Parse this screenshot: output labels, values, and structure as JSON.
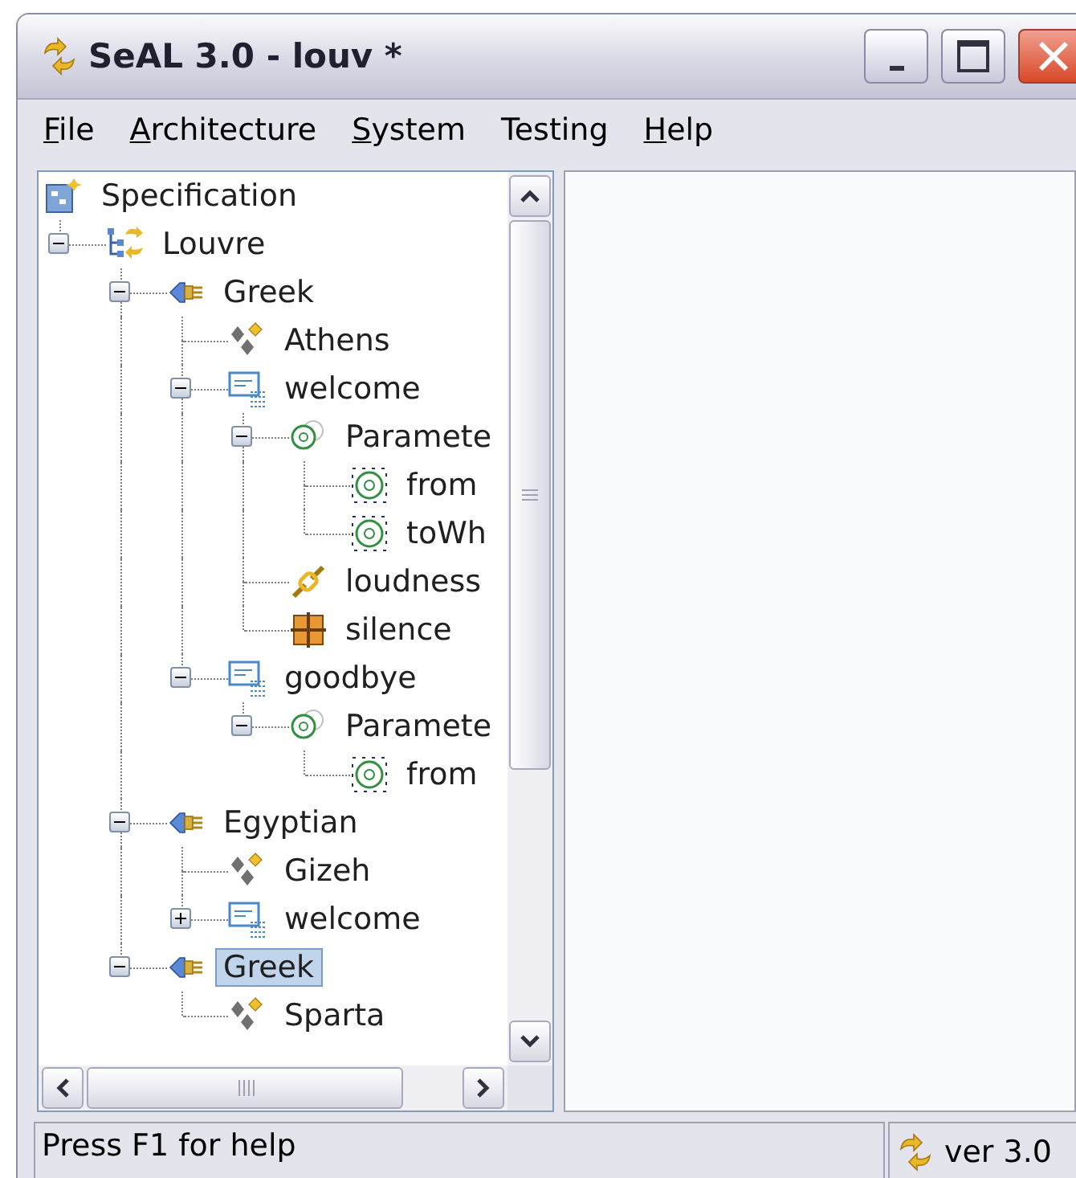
{
  "window": {
    "title": "SeAL 3.0 - louv *"
  },
  "menu": [
    {
      "label": "File",
      "underlined": true
    },
    {
      "label": "Architecture",
      "underlined": true
    },
    {
      "label": "System",
      "underlined": true
    },
    {
      "label": "Testing",
      "underlined": false
    },
    {
      "label": "Help",
      "underlined": true
    }
  ],
  "tree": {
    "label": "Specification",
    "kind": "specification",
    "selected": false,
    "children": [
      {
        "label": "Louvre",
        "kind": "system",
        "selected": false,
        "expanded": true,
        "children": [
          {
            "label": "Greek",
            "kind": "component",
            "selected": false,
            "expanded": true,
            "children": [
              {
                "label": "Athens",
                "kind": "node",
                "selected": false
              },
              {
                "label": "welcome",
                "kind": "interface",
                "selected": false,
                "expanded": true,
                "children": [
                  {
                    "label": "Paramete",
                    "kind": "parameters",
                    "selected": false,
                    "expanded": true,
                    "children": [
                      {
                        "label": "from",
                        "kind": "parameter",
                        "selected": false
                      },
                      {
                        "label": "toWh",
                        "kind": "parameter",
                        "selected": false
                      }
                    ]
                  },
                  {
                    "label": "loudness",
                    "kind": "link",
                    "selected": false
                  },
                  {
                    "label": "silence",
                    "kind": "grid",
                    "selected": false
                  }
                ]
              },
              {
                "label": "goodbye",
                "kind": "interface",
                "selected": false,
                "expanded": true,
                "children": [
                  {
                    "label": "Paramete",
                    "kind": "parameters",
                    "selected": false,
                    "expanded": true,
                    "children": [
                      {
                        "label": "from",
                        "kind": "parameter",
                        "selected": false
                      }
                    ]
                  }
                ]
              }
            ]
          },
          {
            "label": "Egyptian",
            "kind": "component",
            "selected": false,
            "expanded": true,
            "children": [
              {
                "label": "Gizeh",
                "kind": "node",
                "selected": false
              },
              {
                "label": "welcome",
                "kind": "interface",
                "selected": false,
                "expanded": false
              }
            ]
          },
          {
            "label": "Greek",
            "kind": "component",
            "selected": true,
            "expanded": true,
            "children": [
              {
                "label": "Sparta",
                "kind": "node",
                "selected": false
              }
            ]
          }
        ]
      }
    ]
  },
  "status_bar": {
    "message": "Press F1 for help",
    "version": "ver 3.0"
  }
}
